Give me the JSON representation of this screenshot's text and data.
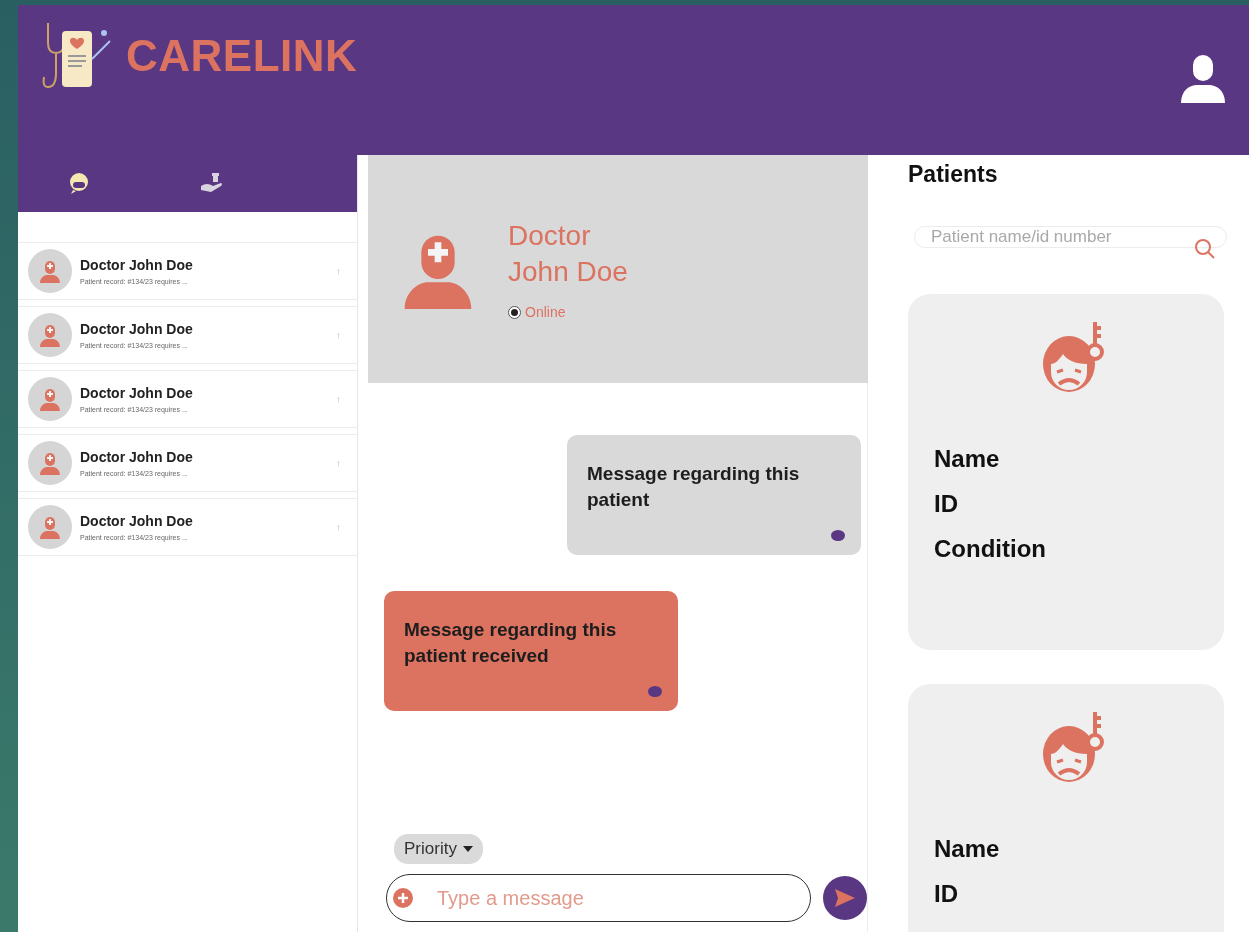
{
  "brand": {
    "name": "CARELINK"
  },
  "sidebar": {
    "tabs": [
      {
        "kind": "chat",
        "selected": true
      },
      {
        "kind": "care",
        "selected": false
      }
    ],
    "conversations": [
      {
        "name": "Doctor John Doe",
        "preview": "Patient record: #134/23 requires ...",
        "mark": "↑"
      },
      {
        "name": "Doctor John Doe",
        "preview": "Patient record: #134/23 requires ...",
        "mark": "↑"
      },
      {
        "name": "Doctor John Doe",
        "preview": "Patient record: #134/23 requires ...",
        "mark": "↑"
      },
      {
        "name": "Doctor John Doe",
        "preview": "Patient record: #134/23 requires ...",
        "mark": "↑"
      },
      {
        "name": "Doctor John Doe",
        "preview": "Patient record: #134/23 requires ...",
        "mark": "↑"
      }
    ]
  },
  "chat": {
    "contact": {
      "title": "Doctor",
      "name": "John Doe",
      "status": "Online",
      "online": true
    },
    "messages": [
      {
        "kind": "sent",
        "text": "Message regarding this patient"
      },
      {
        "kind": "received",
        "text": "Message regarding this patient received"
      }
    ],
    "priority": "Priority",
    "composer": {
      "placeholder": "Type a message"
    }
  },
  "patients": {
    "title": "Patients",
    "search": {
      "placeholder": "Patient name/id number"
    },
    "cards": [
      {
        "fields": [
          "Name",
          "ID",
          "Condition"
        ]
      },
      {
        "fields": [
          "Name",
          "ID"
        ]
      }
    ]
  }
}
